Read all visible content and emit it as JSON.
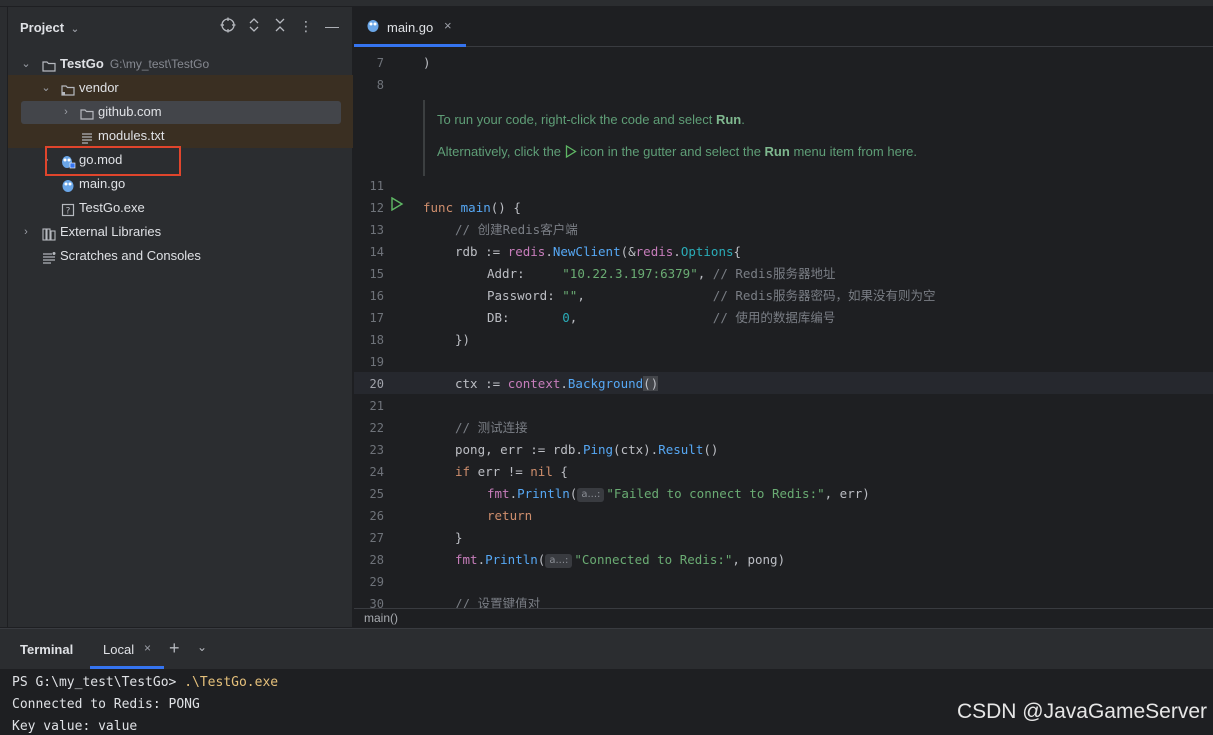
{
  "project": {
    "title": "Project",
    "tree": [
      {
        "label": "TestGo",
        "path": "G:\\my_test\\TestGo"
      },
      {
        "label": "vendor"
      },
      {
        "label": "github.com"
      },
      {
        "label": "modules.txt"
      },
      {
        "label": "go.mod"
      },
      {
        "label": "main.go"
      },
      {
        "label": "TestGo.exe"
      },
      {
        "label": "External Libraries"
      },
      {
        "label": "Scratches and Consoles"
      }
    ]
  },
  "editor": {
    "tab_label": "main.go",
    "doc": {
      "line1_pre": "To run your code, right-click the code and select ",
      "line1_bold": "Run",
      "line1_post": ".",
      "line2_pre": "Alternatively, click the ",
      "line2_mid": " icon in the gutter and select the ",
      "line2_bold": "Run",
      "line2_post": " menu item from here."
    },
    "line_numbers": [
      "7",
      "8",
      "11",
      "12",
      "13",
      "14",
      "15",
      "16",
      "17",
      "18",
      "19",
      "20",
      "21",
      "22",
      "23",
      "24",
      "25",
      "26",
      "27",
      "28",
      "29",
      "30"
    ],
    "code": {
      "l7": ")",
      "l12_kw": "func",
      "l12_fn": "main",
      "l12_rest": "() {",
      "l13": "// 创建Redis客户端",
      "l14_a": "rdb := ",
      "l14_pkg": "redis",
      "l14_fn": "NewClient",
      "l14_b": "(&",
      "l14_pkg2": "redis",
      "l14_typ": "Options",
      "l14_c": "{",
      "l15_key": "Addr:     ",
      "l15_str": "\"10.22.3.197:6379\"",
      "l15_cmt": "// Redis服务器地址",
      "l16_key": "Password: ",
      "l16_str": "\"\"",
      "l16_cmt": "// Redis服务器密码，如果没有则为空",
      "l17_key": "DB:       ",
      "l17_num": "0",
      "l17_cmt": "// 使用的数据库编号",
      "l18": "})",
      "l20_a": "ctx := ",
      "l20_pkg": "context",
      "l20_fn": "Background",
      "l20_b": "()",
      "l22": "// 测试连接",
      "l23_a": "pong, err := rdb.",
      "l23_fn": "Ping",
      "l23_b": "(ctx).",
      "l23_fn2": "Result",
      "l23_c": "()",
      "l24_kw": "if",
      "l24_a": " err != ",
      "l24_kw2": "nil",
      "l24_b": " {",
      "l25_pkg": "fmt",
      "l25_fn": "Println",
      "l25_hint": "a...:",
      "l25_str": "\"Failed to connect to Redis:\"",
      "l25_b": ", err)",
      "l26_kw": "return",
      "l27": "}",
      "l28_pkg": "fmt",
      "l28_fn": "Println",
      "l28_hint": "a...:",
      "l28_str": "\"Connected to Redis:\"",
      "l28_b": ", pong)",
      "l30": "// 设置键值对"
    },
    "breadcrumb": "main()"
  },
  "terminal": {
    "title": "Terminal",
    "tab_label": "Local",
    "lines": {
      "prompt": "PS G:\\my_test\\TestGo> ",
      "command": ".\\TestGo.exe",
      "out1": "Connected to Redis: PONG",
      "out2": "Key value: value"
    }
  },
  "watermark": "CSDN @JavaGameServer",
  "colors": {
    "accent": "#3574f0",
    "highlight_box": "#e0452c",
    "vendor_bg": "#3a2f22"
  }
}
